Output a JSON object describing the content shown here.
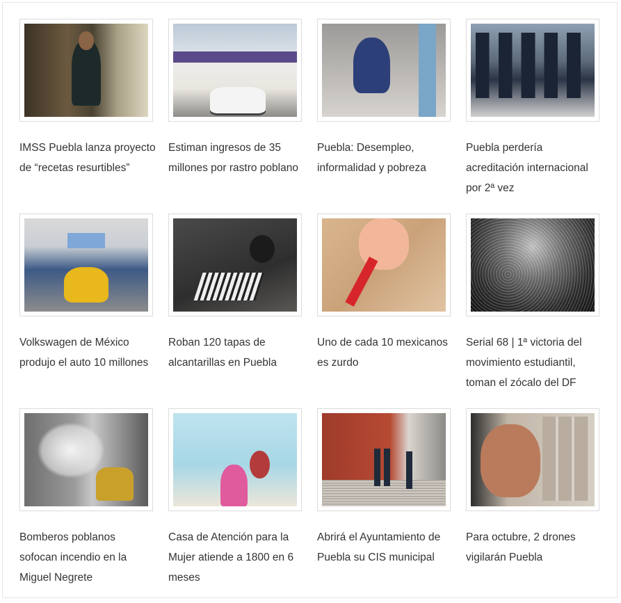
{
  "articles": [
    {
      "title": "IMSS Puebla lanza proyecto de “recetas resurtibles”",
      "image": "pharmacy-photo"
    },
    {
      "title": "Estiman ingresos de 35 millones por rastro poblano",
      "image": "slaughterhouse-building-photo"
    },
    {
      "title": "Puebla: Desempleo, informalidad y pobreza",
      "image": "street-worker-photo"
    },
    {
      "title": "Puebla perdería acreditación internacional por 2ª vez",
      "image": "police-march-photo"
    },
    {
      "title": "Volkswagen de México produjo el auto 10 millones",
      "image": "vw-beetle-photo"
    },
    {
      "title": "Roban 120 tapas de alcantarillas en Puebla",
      "image": "open-manhole-photo"
    },
    {
      "title": "Uno de cada 10 mexicanos es zurdo",
      "image": "child-drawing-photo"
    },
    {
      "title": "Serial 68 | 1ª victoria del movimiento estudiantil, toman el zócalo del DF",
      "image": "crowd-zocalo-photo"
    },
    {
      "title": "Bomberos poblanos sofocan incendio en la Miguel Negrete",
      "image": "firefighters-photo"
    },
    {
      "title": "Casa de Atención para la Mujer atiende a 1800 en 6 meses",
      "image": "office-photo"
    },
    {
      "title": "Abrirá el Ayuntamiento de Puebla su CIS municipal",
      "image": "municipal-building-photo"
    },
    {
      "title": "Para octubre, 2 drones vigilarán Puebla",
      "image": "official-portrait-photo"
    }
  ]
}
